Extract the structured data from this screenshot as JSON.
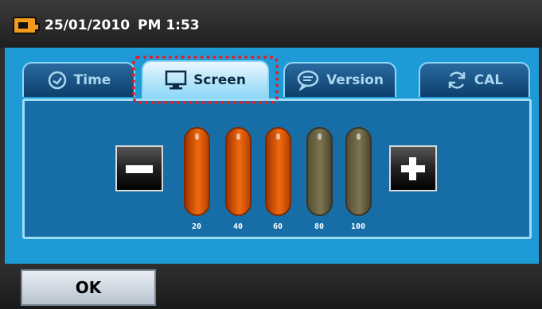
{
  "status": {
    "date": "25/01/2010",
    "time": "PM 1:53"
  },
  "tabs": [
    {
      "label": "Time",
      "icon": "clock-icon"
    },
    {
      "label": "Screen",
      "icon": "monitor-icon",
      "active": true
    },
    {
      "label": "Version",
      "icon": "speech-bubble-icon"
    },
    {
      "label": "CAL",
      "icon": "refresh-icon"
    }
  ],
  "brightness": {
    "levels": [
      "20",
      "40",
      "60",
      "80",
      "100"
    ],
    "current_level": 60,
    "decrease_icon": "minus-icon",
    "increase_icon": "plus-icon"
  },
  "footer": {
    "ok_label": "OK"
  },
  "colors": {
    "panel": "#1e9ad6",
    "active_bar": "#f06a10",
    "inactive_bar": "#7c7550",
    "selection": "#e3202a"
  }
}
